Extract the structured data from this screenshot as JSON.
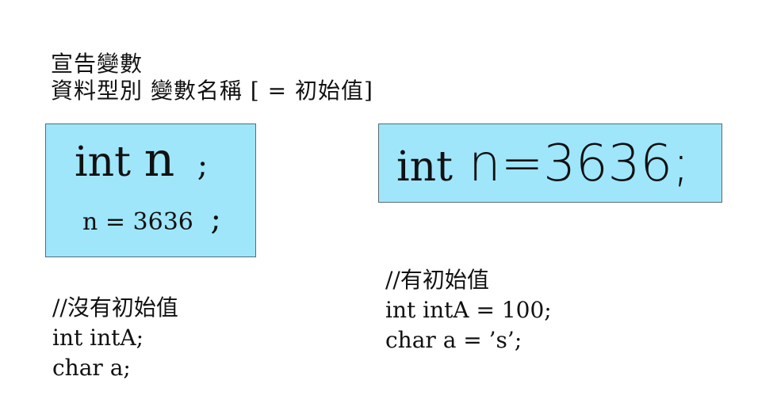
{
  "heading": {
    "line1": "宣告變數",
    "line2": "資料型別 變數名稱 [ = 初始值]"
  },
  "left_box": {
    "decl_keyword": "int",
    "decl_name": "n",
    "decl_semicolon": ";",
    "assign_text": "n = 3636",
    "assign_semicolon": ";",
    "background_color": "#9fe6fb"
  },
  "right_box": {
    "keyword": "int",
    "rest": "n=3636;",
    "background_color": "#9fe6fb"
  },
  "code_left": {
    "comment": "//沒有初始值",
    "line1": "int intA;",
    "line2": "char a;"
  },
  "code_right": {
    "comment": "//有初始值",
    "line1": "int intA = 100;",
    "line2": "char a = ’s’;"
  }
}
